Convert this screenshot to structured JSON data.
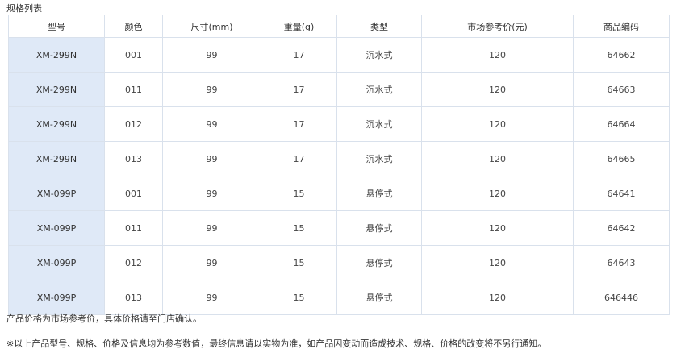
{
  "section_title": "规格列表",
  "table": {
    "headers": [
      "型号",
      "颜色",
      "尺寸(mm)",
      "重量(g)",
      "类型",
      "市场参考价(元)",
      "商品编码"
    ],
    "rows": [
      [
        "XM-299N",
        "001",
        "99",
        "17",
        "沉水式",
        "120",
        "64662"
      ],
      [
        "XM-299N",
        "011",
        "99",
        "17",
        "沉水式",
        "120",
        "64663"
      ],
      [
        "XM-299N",
        "012",
        "99",
        "17",
        "沉水式",
        "120",
        "64664"
      ],
      [
        "XM-299N",
        "013",
        "99",
        "17",
        "沉水式",
        "120",
        "64665"
      ],
      [
        "XM-099P",
        "001",
        "99",
        "15",
        "悬停式",
        "120",
        "64641"
      ],
      [
        "XM-099P",
        "011",
        "99",
        "15",
        "悬停式",
        "120",
        "64642"
      ],
      [
        "XM-099P",
        "012",
        "99",
        "15",
        "悬停式",
        "120",
        "64643"
      ],
      [
        "XM-099P",
        "013",
        "99",
        "15",
        "悬停式",
        "120",
        "646446"
      ]
    ]
  },
  "notes": [
    "产品价格为市场参考价，具体价格请至门店确认。",
    "※以上产品型号、规格、价格及信息均为参考数值，最终信息请以实物为准，如产品因变动而造成技术、规格、价格的改变将不另行通知。"
  ],
  "colors": {
    "model_cell_bg": "#dfe9f7",
    "border": "#d9e1ec"
  }
}
